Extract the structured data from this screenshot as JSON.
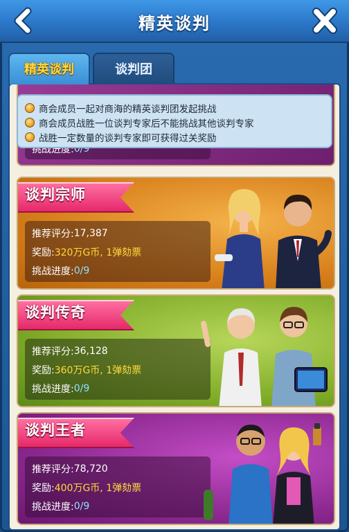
{
  "header": {
    "title": "精英谈判"
  },
  "tabs": [
    {
      "label": "精英谈判",
      "active": true
    },
    {
      "label": "谈判团",
      "active": false
    }
  ],
  "info": {
    "lines": [
      "商会成员一起对商海的精英谈判团发起挑战",
      "商会成员战胜一位谈判专家后不能挑战其他谈判专家",
      "战胜一定数量的谈判专家即可获得过关奖励"
    ]
  },
  "partial_card": {
    "progress_label": "挑战进度: ",
    "progress": "0/9"
  },
  "cards": [
    {
      "name": "谈判宗师",
      "score_label": "推荐评分: ",
      "score": "17,387",
      "reward_label": "奖励: ",
      "reward": "320万G币, 1弹劾票",
      "progress_label": "挑战进度: ",
      "progress": "0/9"
    },
    {
      "name": "谈判传奇",
      "score_label": "推荐评分: ",
      "score": "36,128",
      "reward_label": "奖励: ",
      "reward": "360万G币, 1弹劾票",
      "progress_label": "挑战进度: ",
      "progress": "0/9"
    },
    {
      "name": "谈判王者",
      "score_label": "推荐评分: ",
      "score": "78,720",
      "reward_label": "奖励: ",
      "reward": "400万G币, 1弹劾票",
      "progress_label": "挑战进度: ",
      "progress": "0/9"
    }
  ],
  "colors": {
    "header_blue": "#2b77c8",
    "active_tab_text": "#ffd93d",
    "ribbon_pink": "#e5296a",
    "reward_gold": "#ffd93d",
    "progress_cyan": "#8fe3ff"
  },
  "icons": [
    "back-arrow-icon",
    "close-x-icon",
    "coin-bullet-icon"
  ]
}
